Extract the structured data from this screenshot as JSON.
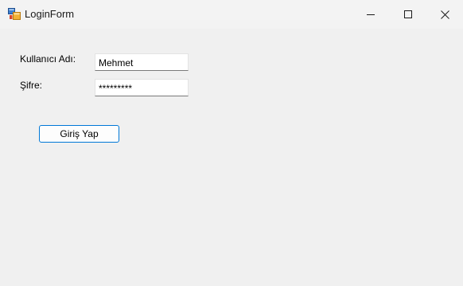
{
  "window": {
    "title": "LoginForm",
    "icon": "winforms-app-icon",
    "controls": {
      "minimize_icon": "minimize-icon",
      "maximize_icon": "maximize-icon",
      "close_icon": "close-icon"
    }
  },
  "form": {
    "username_label": "Kullanıcı Adı:",
    "username_value": "Mehmet",
    "password_label": "Şifre:",
    "password_value": "*********",
    "login_button": "Giriş Yap"
  },
  "colors": {
    "background": "#f0f0f0",
    "accent_border": "#0078d7"
  }
}
